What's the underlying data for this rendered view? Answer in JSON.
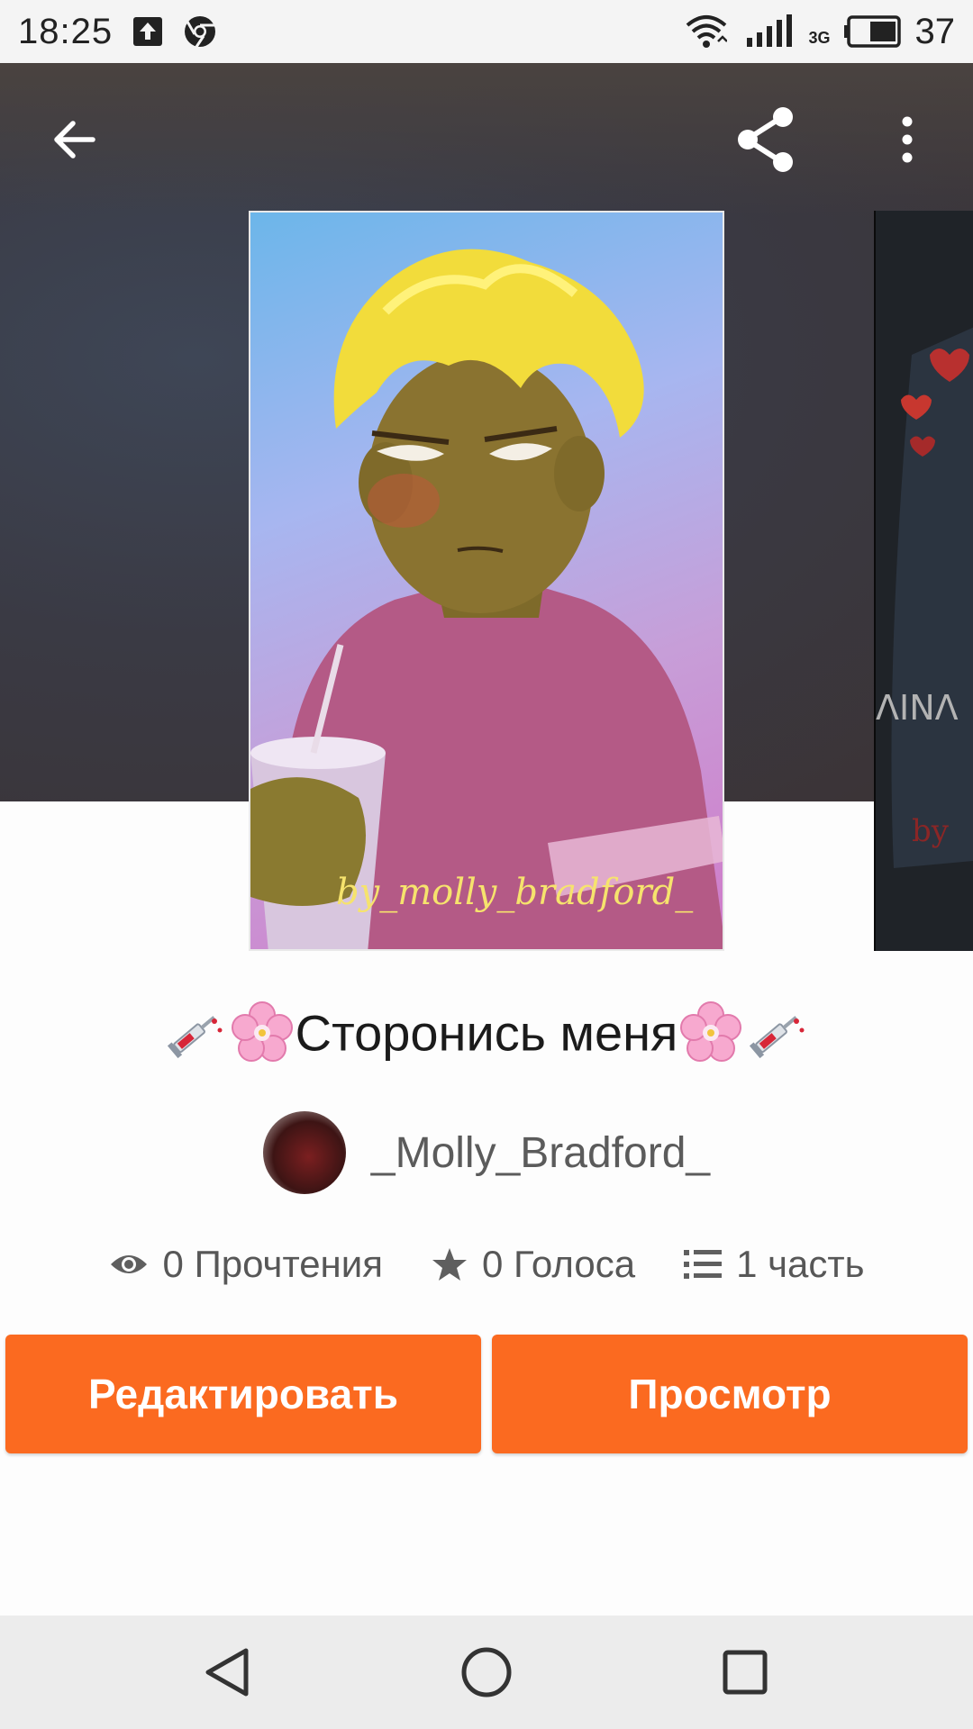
{
  "status_bar": {
    "time": "18:25",
    "network_label": "3G",
    "battery": "37",
    "icons": [
      "upload-icon",
      "chrome-icon",
      "wifi-icon",
      "signal-icon",
      "battery-icon"
    ]
  },
  "topbar": {
    "icons": [
      "back-arrow-icon",
      "share-icon",
      "more-vert-icon"
    ]
  },
  "cover": {
    "signature": "by_molly_bradford_"
  },
  "story": {
    "title": "Сторонись меня",
    "title_emoji_left": [
      "syringe-icon",
      "cherry-blossom-icon"
    ],
    "title_emoji_right": [
      "cherry-blossom-icon",
      "syringe-icon"
    ],
    "author": "_Molly_Bradford_"
  },
  "stats": {
    "reads": "0 Прочтения",
    "votes": "0 Голоса",
    "parts": "1 часть"
  },
  "actions": {
    "edit": "Редактировать",
    "view": "Просмотр"
  },
  "colors": {
    "accent": "#fb6a20",
    "hero_bg": "#3b3538",
    "text_primary": "#1b1b1b",
    "text_secondary": "#575757"
  }
}
